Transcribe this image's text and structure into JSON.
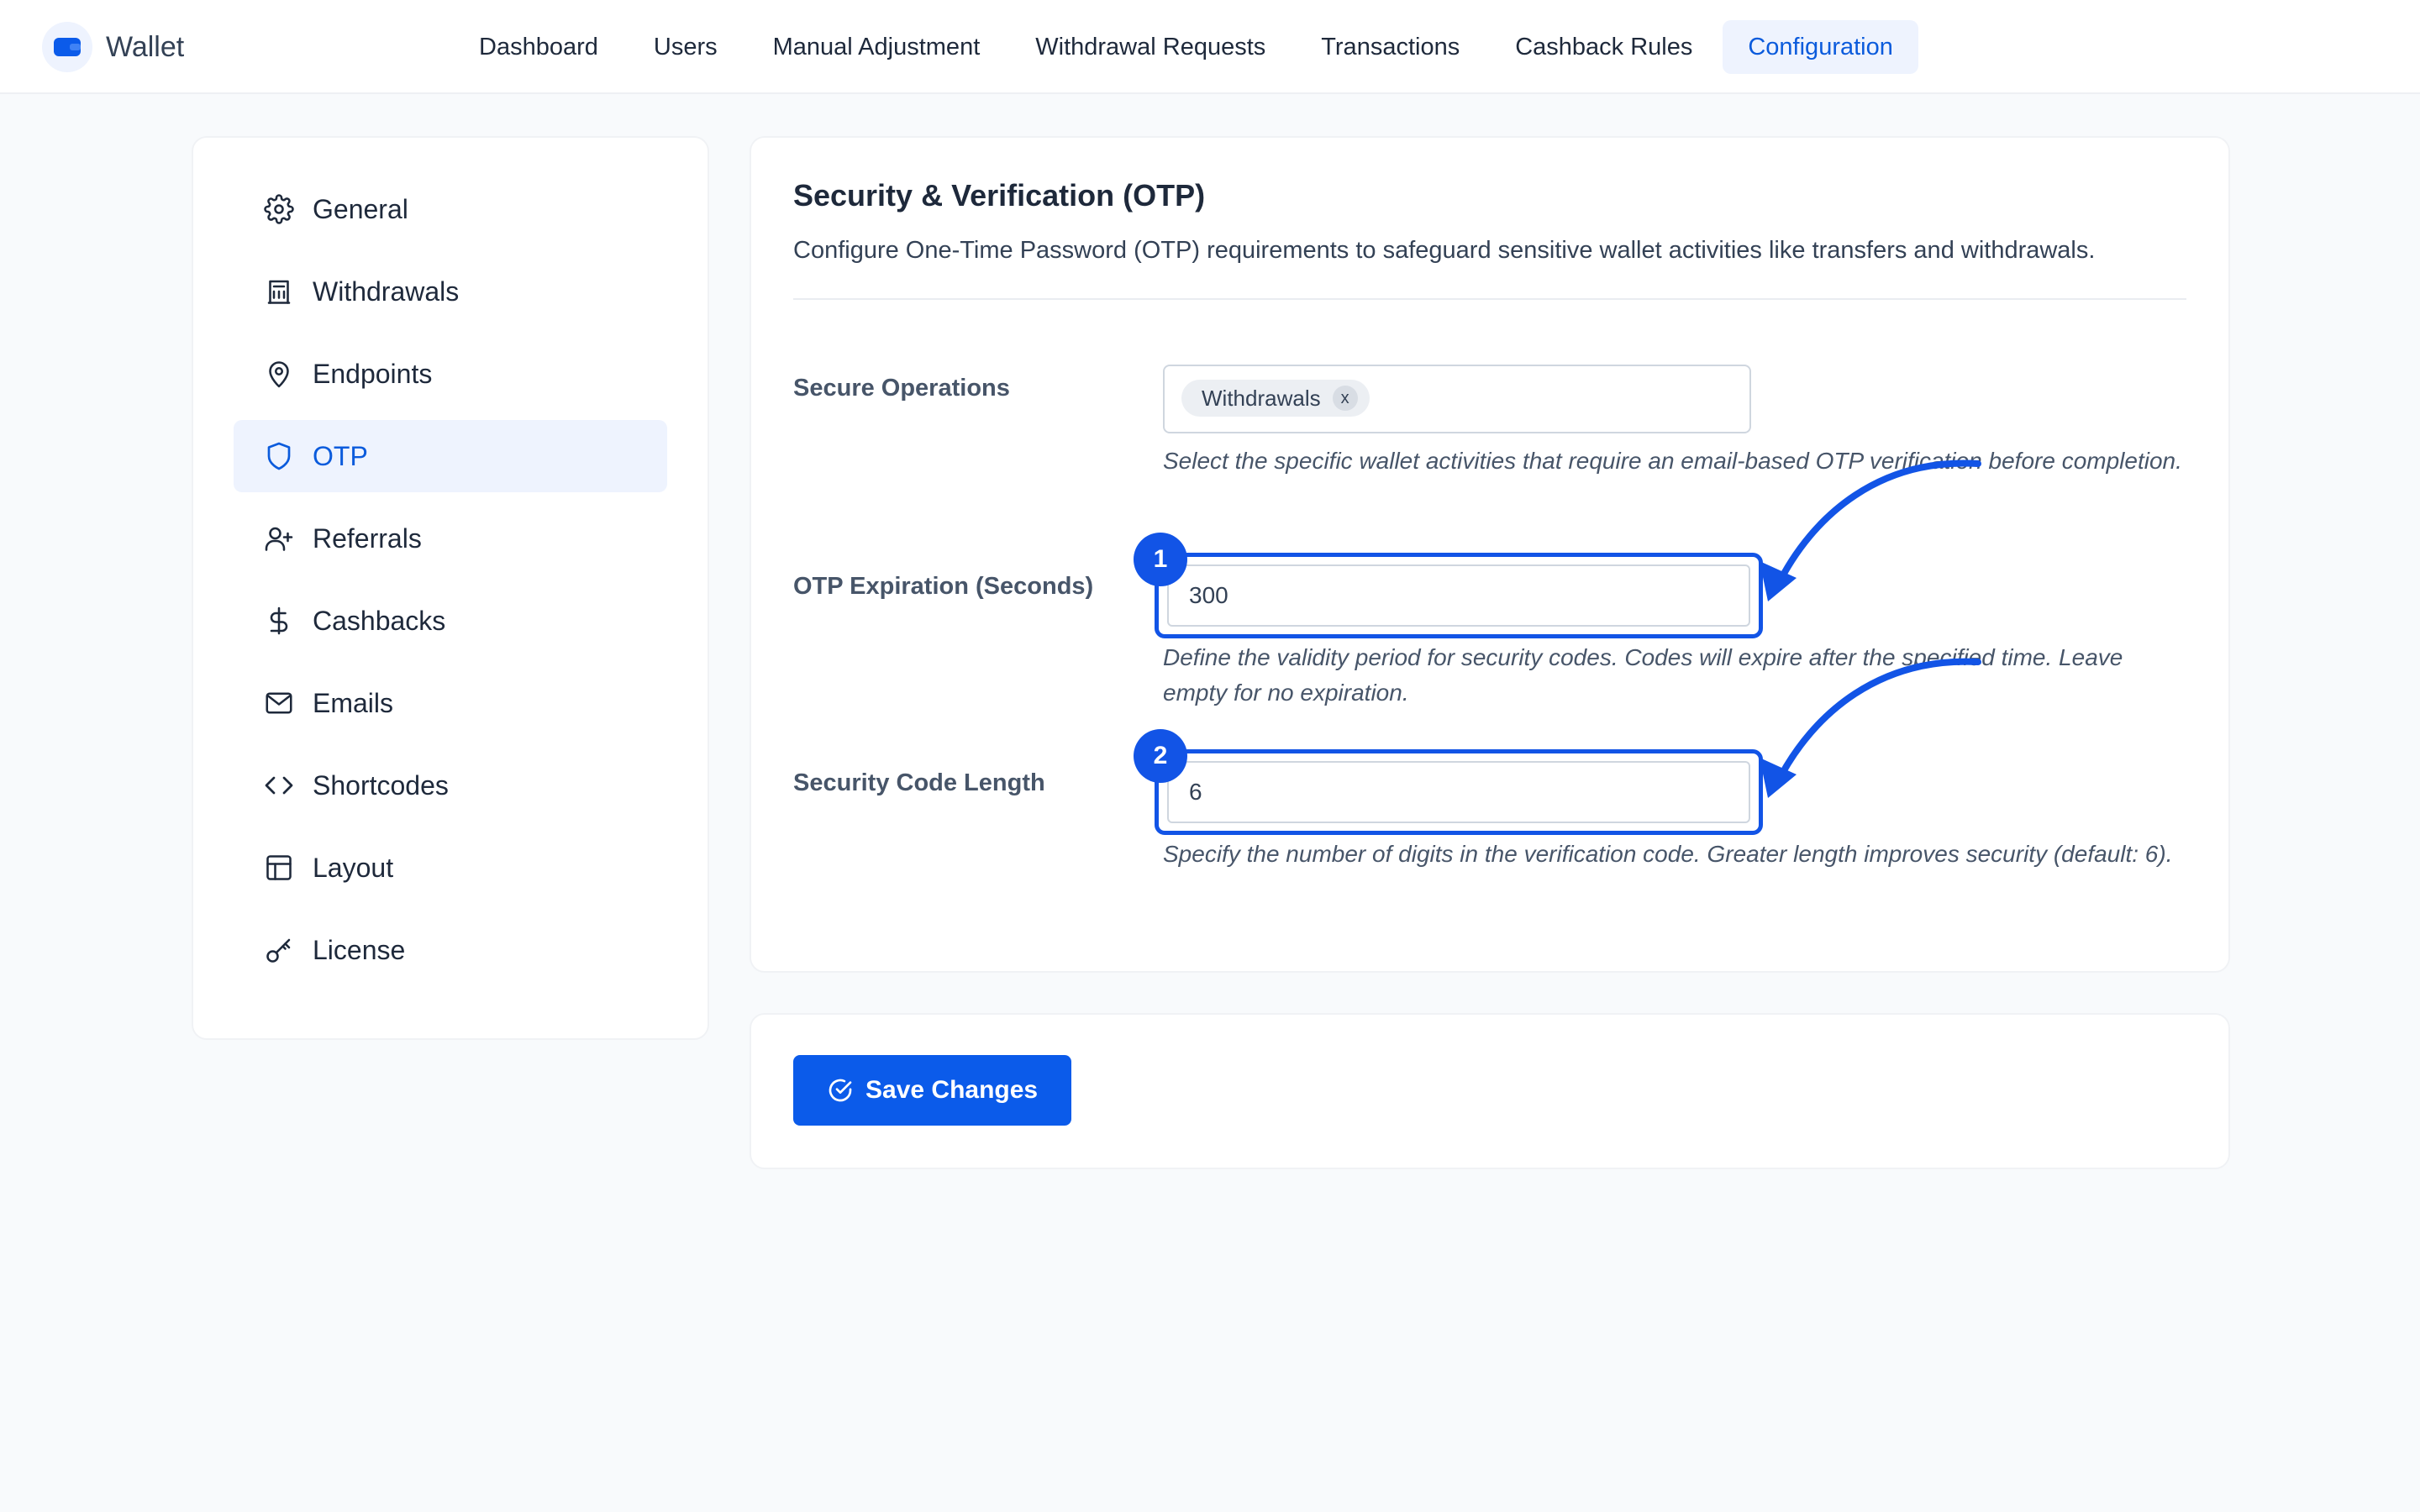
{
  "app": {
    "name": "Wallet"
  },
  "nav": {
    "items": [
      {
        "label": "Dashboard"
      },
      {
        "label": "Users"
      },
      {
        "label": "Manual Adjustment"
      },
      {
        "label": "Withdrawal Requests"
      },
      {
        "label": "Transactions"
      },
      {
        "label": "Cashback Rules"
      },
      {
        "label": "Configuration",
        "active": true
      }
    ]
  },
  "sidebar": {
    "items": [
      {
        "label": "General",
        "icon": "gear-icon"
      },
      {
        "label": "Withdrawals",
        "icon": "bank-icon"
      },
      {
        "label": "Endpoints",
        "icon": "map-pin-icon"
      },
      {
        "label": "OTP",
        "icon": "shield-icon",
        "active": true
      },
      {
        "label": "Referrals",
        "icon": "user-plus-icon"
      },
      {
        "label": "Cashbacks",
        "icon": "dollar-icon"
      },
      {
        "label": "Emails",
        "icon": "mail-icon"
      },
      {
        "label": "Shortcodes",
        "icon": "code-icon"
      },
      {
        "label": "Layout",
        "icon": "layout-icon"
      },
      {
        "label": "License",
        "icon": "key-icon"
      }
    ]
  },
  "section": {
    "title": "Security & Verification (OTP)",
    "description": "Configure One-Time Password (OTP) requirements to safeguard sensitive wallet activities like transfers and withdrawals."
  },
  "fields": {
    "secure_operations": {
      "label": "Secure Operations",
      "chips": [
        "Withdrawals"
      ],
      "chip_remove": "x",
      "help": "Select the specific wallet activities that require an email-based OTP verification before completion."
    },
    "otp_expiration": {
      "label": "OTP Expiration (Seconds)",
      "value": "300",
      "badge": "1",
      "help": "Define the validity period for security codes. Codes will expire after the specified time. Leave empty for no expiration."
    },
    "code_length": {
      "label": "Security Code Length",
      "value": "6",
      "badge": "2",
      "help": "Specify the number of digits in the verification code. Greater length improves security (default: 6)."
    }
  },
  "actions": {
    "save_label": "Save Changes"
  },
  "colors": {
    "accent": "#0b5bea",
    "annotation": "#1254e6",
    "active_bg": "#eef3fe"
  }
}
